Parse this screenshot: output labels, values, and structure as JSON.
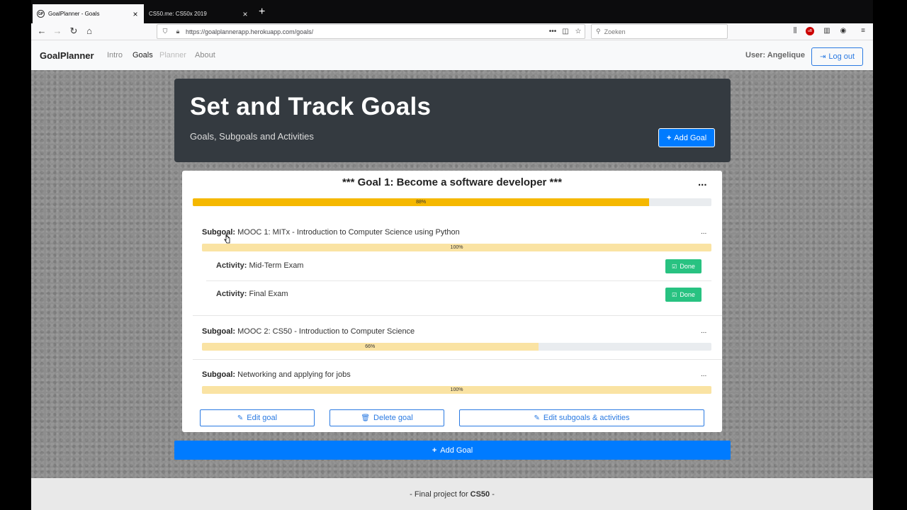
{
  "browser": {
    "tabs": [
      {
        "title": "GoalPlanner - Goals",
        "favicon": "GP",
        "active": true
      },
      {
        "title": "CS50.me: CS50x 2019",
        "active": false
      }
    ],
    "url": "https://goalplannerapp.herokuapp.com/goals/",
    "search_placeholder": "Zoeken"
  },
  "site": {
    "brand": "GoalPlanner",
    "nav": [
      "Intro",
      "Goals",
      "Planner",
      "About"
    ],
    "user": "User: Angelique",
    "logout": "Log out"
  },
  "jumbotron": {
    "title": "Set and Track Goals",
    "subtitle": "Goals, Subgoals and Activities",
    "add_goal": "Add Goal"
  },
  "goal": {
    "title": "*** Goal 1: Become a software developer ***",
    "menu": "...",
    "progress_label": "88%",
    "progress": 88,
    "subgoals": [
      {
        "label": "Subgoal:",
        "name": "MOOC 1: MITx - Introduction to Computer Science using Python",
        "progress_label": "100%",
        "progress": 100,
        "menu": "...",
        "activities": [
          {
            "label": "Activity:",
            "name": "Mid-Term Exam",
            "button": "Done"
          },
          {
            "label": "Activity:",
            "name": "Final Exam",
            "button": "Done"
          }
        ]
      },
      {
        "label": "Subgoal:",
        "name": "MOOC 2: CS50 - Introduction to Computer Science",
        "progress_label": "66%",
        "progress": 66,
        "menu": "..."
      },
      {
        "label": "Subgoal:",
        "name": "Networking and applying for jobs",
        "progress_label": "100%",
        "progress": 100,
        "menu": "..."
      }
    ],
    "buttons": {
      "edit": "Edit goal",
      "delete": "Delete goal",
      "edit_sub": "Edit subgoals & activities"
    }
  },
  "bottom_add": "Add Goal",
  "footer": {
    "prefix": "- Final project for",
    "course": "CS50",
    "suffix": "-"
  }
}
